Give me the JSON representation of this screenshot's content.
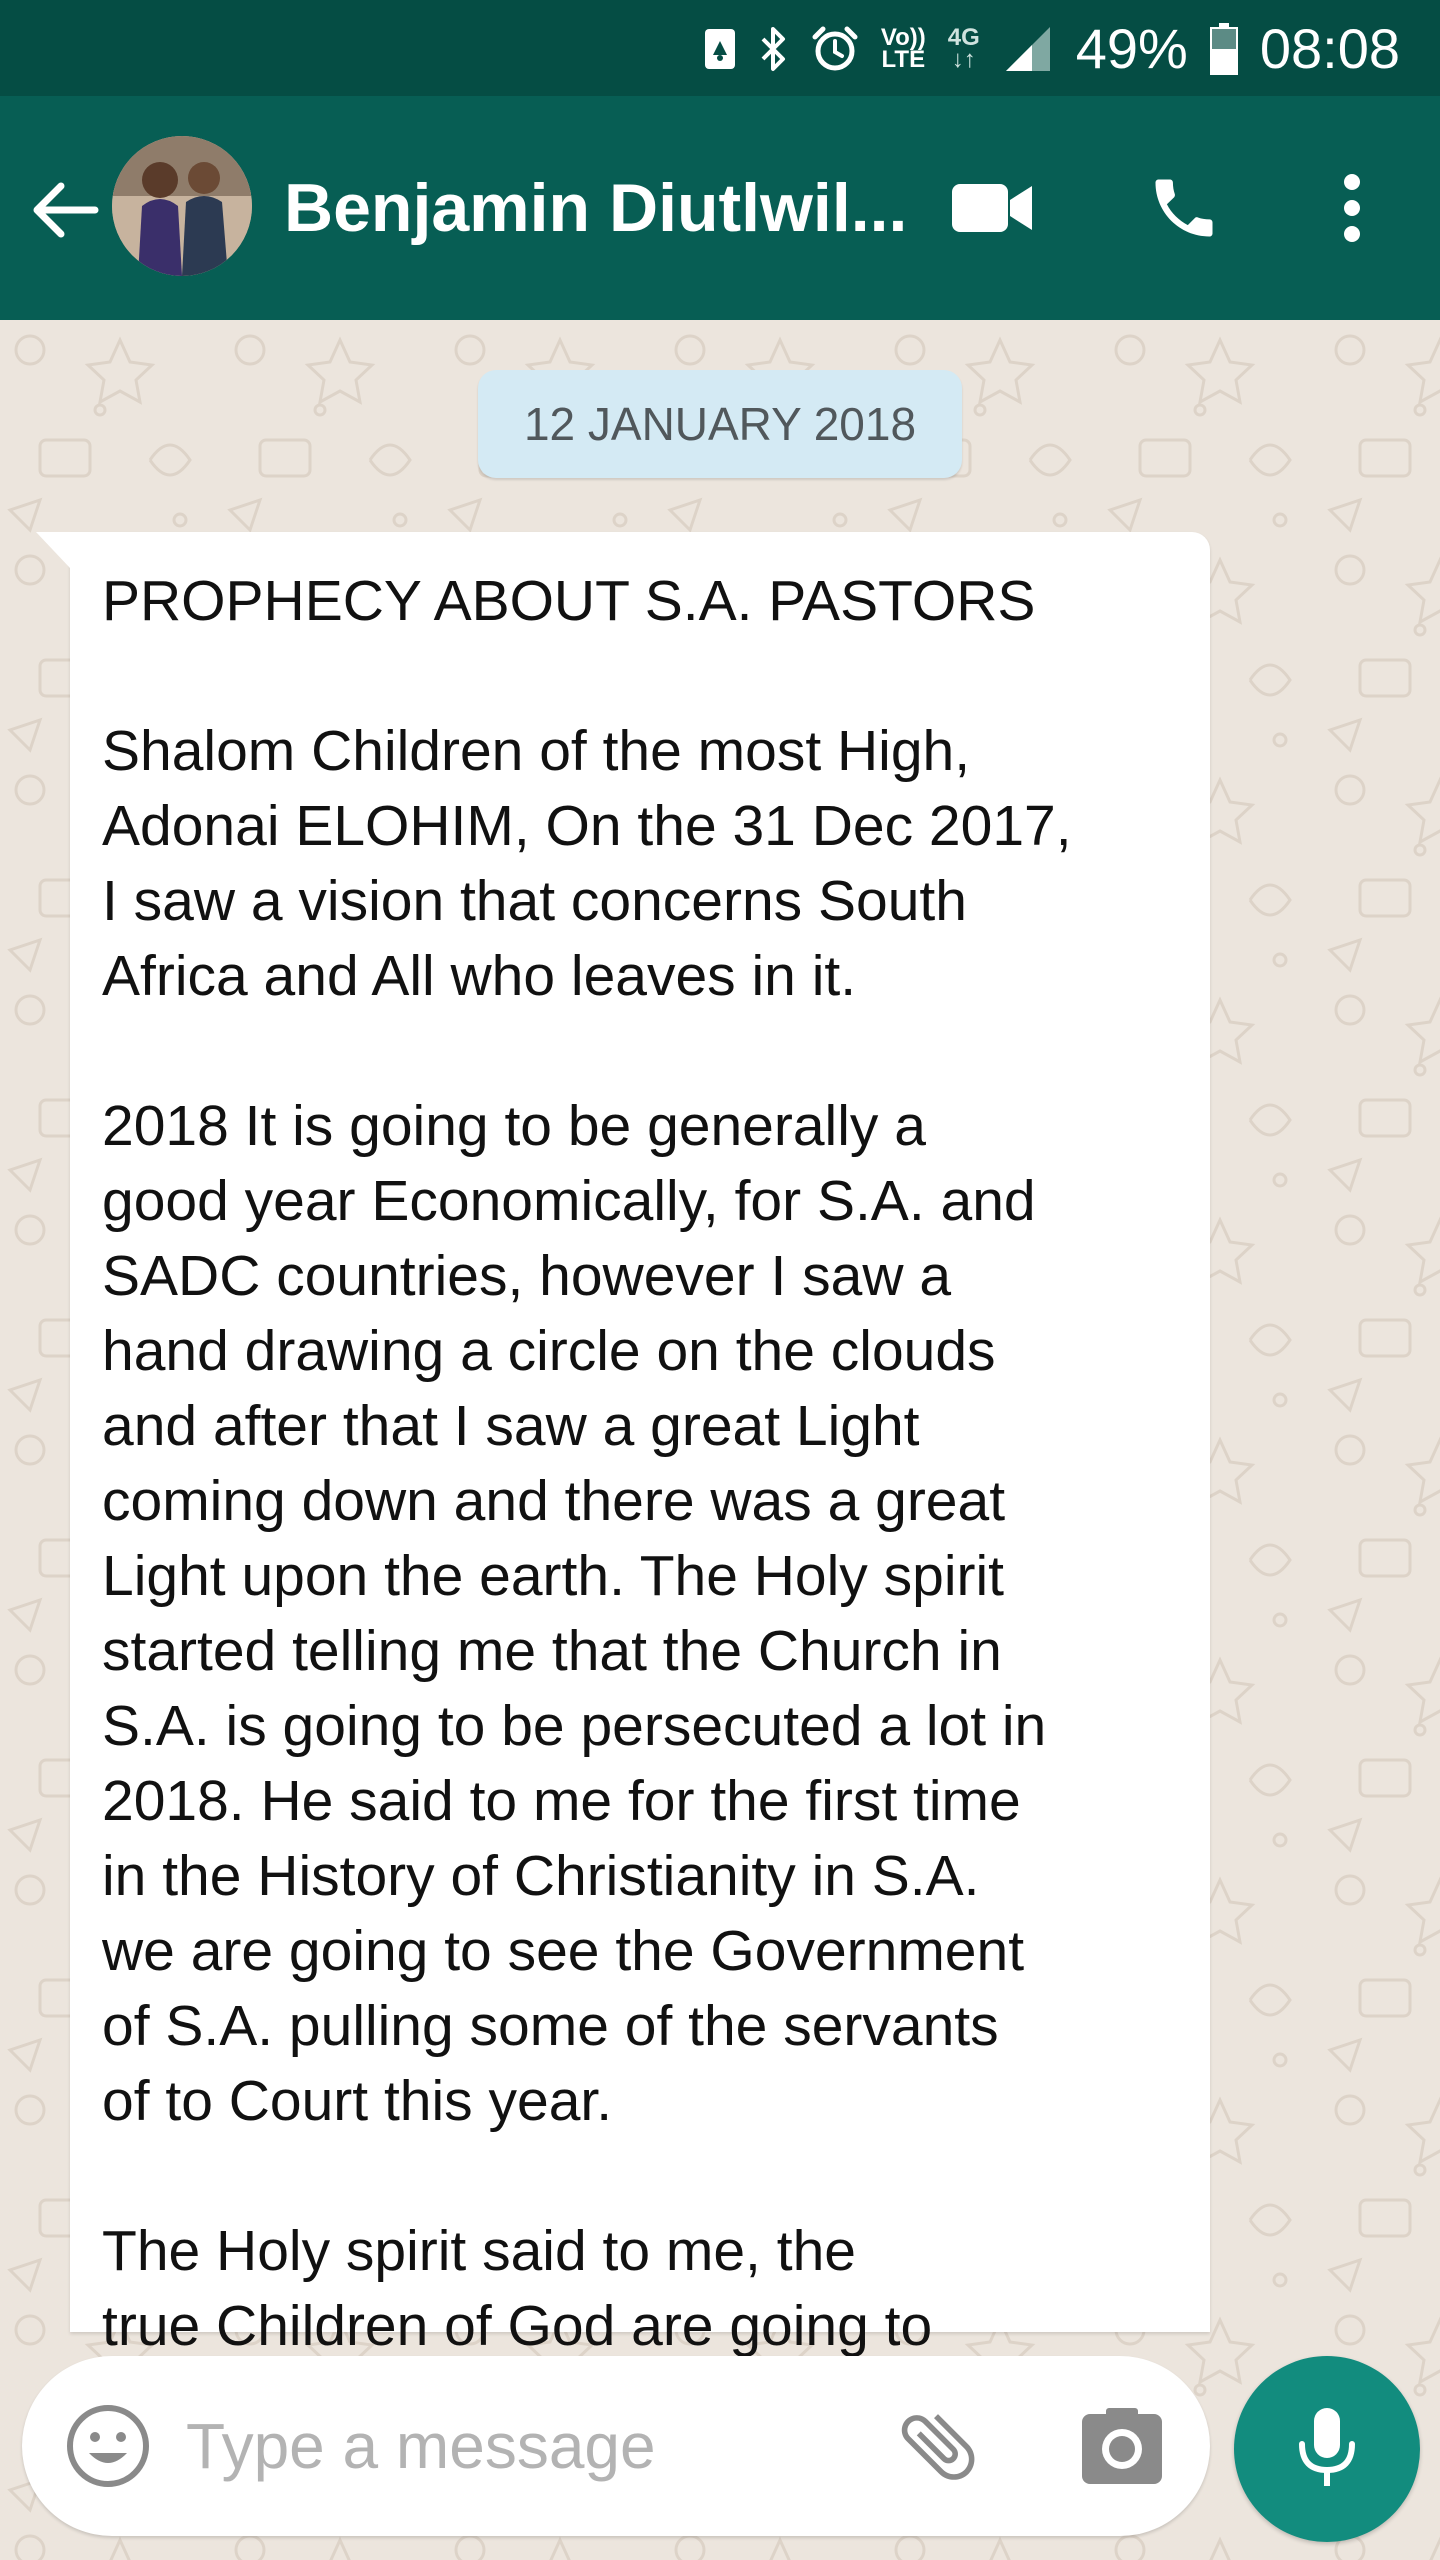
{
  "status_bar": {
    "volte_top": "Vo))",
    "volte_bottom": "LTE",
    "network_type": "4G",
    "battery_percent": "49%",
    "time": "08:08",
    "icons": [
      "nfc-icon",
      "bluetooth-icon",
      "alarm-icon",
      "volte-icon",
      "data-arrows-icon",
      "signal-icon",
      "battery-icon"
    ]
  },
  "header": {
    "contact_name": "Benjamin Diutlwil...",
    "icons": [
      "back-arrow-icon",
      "video-call-icon",
      "voice-call-icon",
      "more-options-icon"
    ]
  },
  "chat": {
    "date_label": "12 JANUARY 2018",
    "message": {
      "text": "PROPHECY ABOUT S.A. PASTORS\n\nShalom Children of the most High,\nAdonai ELOHIM, On the 31 Dec 2017,\nI saw a vision that concerns South\nAfrica and All who leaves in it.\n\n2018 It is going to be generally a\ngood year Economically, for S.A. and\nSADC countries, however I saw a\nhand drawing a circle on the clouds\nand after that I saw a great Light\ncoming down and there was a great\nLight upon the earth. The Holy spirit\nstarted telling me that the Church in\nS.A. is going to be persecuted a lot in\n2018. He said to me for the first time\nin the History of Christianity in S.A.\nwe are going to see the Government\nof S.A. pulling some of the servants\nof to Court this year.\n\nThe Holy spirit said to me, the\ntrue Children of God are going to"
    }
  },
  "composer": {
    "placeholder": "Type a message",
    "value": "",
    "icons": [
      "emoji-icon",
      "attachment-icon",
      "camera-icon",
      "microphone-icon"
    ]
  },
  "colors": {
    "status_bar": "#054d44",
    "app_bar": "#075e54",
    "chat_background": "#ece5dd",
    "date_chip": "#d4eaf4",
    "mic_button": "#128c7e"
  }
}
